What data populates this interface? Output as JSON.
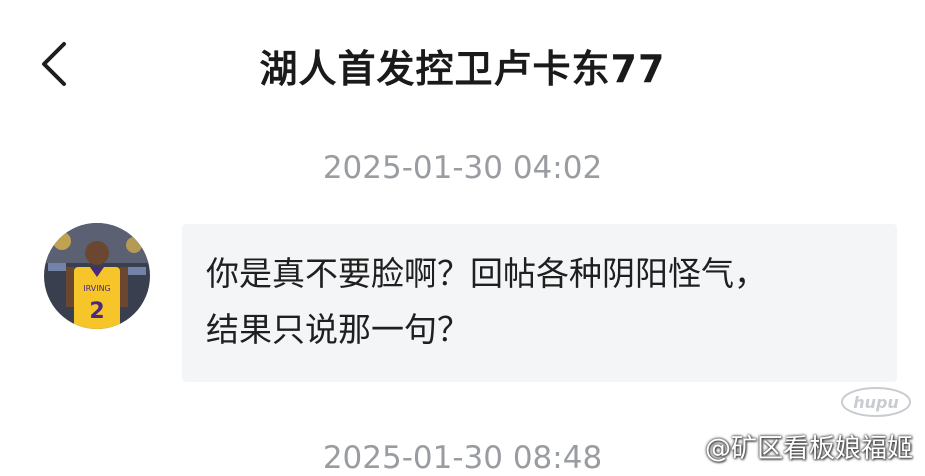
{
  "header": {
    "back_icon": "chevron-left-icon",
    "title": "湖人首发控卫卢卡东77"
  },
  "messages": [
    {
      "timestamp": "2025-01-30 04:02",
      "avatar_icon": "player-avatar",
      "text_line1": "你是真不要脸啊？回帖各种阴阳怪气，",
      "text_line2": "结果只说那一句？"
    },
    {
      "timestamp": "2025-01-30 08:48"
    }
  ],
  "watermark": {
    "logo": "hupu",
    "text": "@矿区看板娘福姬"
  },
  "colors": {
    "title": "#1a1a1a",
    "timestamp": "#999ca1",
    "bubble_bg": "#f4f5f7",
    "jersey_gold": "#f5c52a",
    "jersey_purple": "#4b2a7b"
  }
}
